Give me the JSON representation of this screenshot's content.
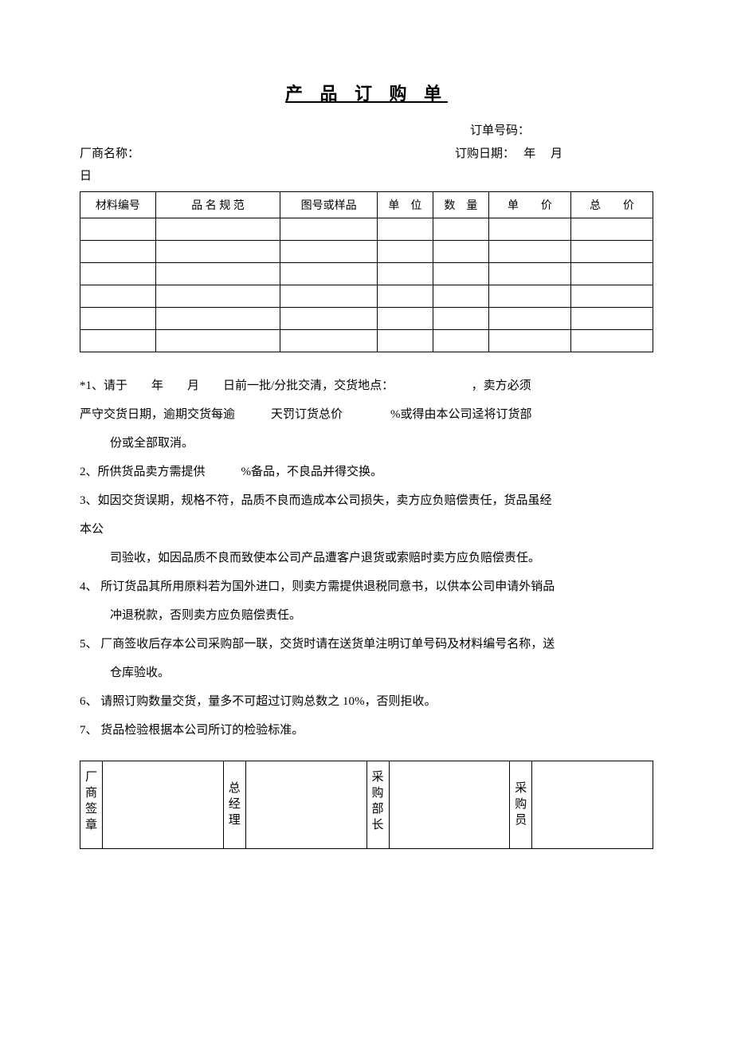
{
  "title": "产 品 订 购 单",
  "header": {
    "order_no_label": "订单号码：",
    "vendor_label": "厂商名称：",
    "order_date_label": "订购日期：　 年　  月",
    "day_trailing": "日"
  },
  "table": {
    "headers": {
      "material_no": "材料编号",
      "name_spec": "品 名 规 范",
      "drawing": "图号或样品",
      "unit": "单　位",
      "qty": "数　量",
      "price": "单　　价",
      "total": "总　　价"
    },
    "rows": [
      {
        "material_no": "",
        "name_spec": "",
        "drawing": "",
        "unit": "",
        "qty": "",
        "price": "",
        "total": ""
      },
      {
        "material_no": "",
        "name_spec": "",
        "drawing": "",
        "unit": "",
        "qty": "",
        "price": "",
        "total": ""
      },
      {
        "material_no": "",
        "name_spec": "",
        "drawing": "",
        "unit": "",
        "qty": "",
        "price": "",
        "total": ""
      },
      {
        "material_no": "",
        "name_spec": "",
        "drawing": "",
        "unit": "",
        "qty": "",
        "price": "",
        "total": ""
      },
      {
        "material_no": "",
        "name_spec": "",
        "drawing": "",
        "unit": "",
        "qty": "",
        "price": "",
        "total": ""
      },
      {
        "material_no": "",
        "name_spec": "",
        "drawing": "",
        "unit": "",
        "qty": "",
        "price": "",
        "total": ""
      }
    ]
  },
  "notes": {
    "n1a": "*1、请于　　年　　月　　日前一批/分批交清，交货地点：　　　　　　　，卖方必须",
    "n1b": "严守交货日期，逾期交货每逾　　　天罚订货总价　　　　%或得由本公司迳将订货部",
    "n1c": "份或全部取消。",
    "n2": "2、所供货品卖方需提供　　　%备品，不良品并得交换。",
    "n3a": "3、如因交货误期，规格不符，品质不良而造成本公司损失，卖方应负赔偿责任，货品虽经",
    "n3b": "本公",
    "n3c": "司验收，如因品质不良而致使本公司产品遭客户退货或索赔时卖方应负赔偿责任。",
    "n4a": "4、 所订货品其所用原料若为国外进口，则卖方需提供退税同意书，以供本公司申请外销品",
    "n4b": "冲退税款，否则卖方应负赔偿责任。",
    "n5a": "5、 厂商签收后存本公司采购部一联，交货时请在送货单注明订单号码及材料编号名称，送",
    "n5b": "仓库验收。",
    "n6": "6、 请照订购数量交货，量多不可超过订购总数之 10%，否则拒收。",
    "n7": "7、 货品检验根据本公司所订的检验标准。"
  },
  "sign": {
    "vendor_seal": "厂商签章",
    "gm": "总经理",
    "purchase_mgr": "采购部长",
    "purchaser": "采购员"
  }
}
